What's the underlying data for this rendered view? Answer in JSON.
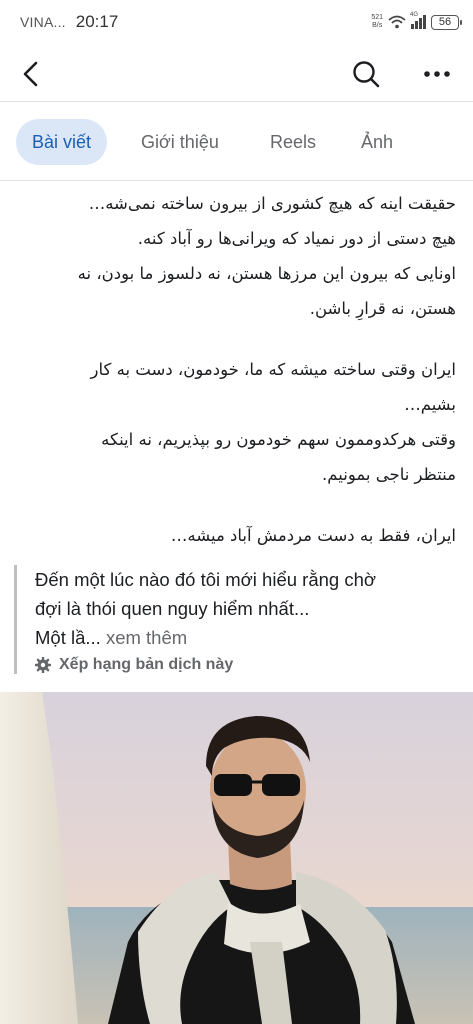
{
  "status_bar": {
    "carrier": "VINA...",
    "time": "20:17",
    "net_speed_top": "521",
    "net_speed_bottom": "B/s",
    "network_label": "4G",
    "battery": "56"
  },
  "nav": {
    "back_icon": "chevron-left-icon",
    "search_icon": "search-icon",
    "more_icon": "more-dots-icon"
  },
  "tabs": [
    {
      "label": "Bài viết",
      "active": true
    },
    {
      "label": "Giới thiệu",
      "active": false
    },
    {
      "label": "Reels",
      "active": false
    },
    {
      "label": "Ảnh",
      "active": false
    }
  ],
  "post": {
    "paragraphs": [
      [
        "حقیقت اینه که هیچ کشوری از بیرون ساخته نمی‌شه…",
        "هیچ دستی از دور نمیاد که ویرانی‌ها رو آباد کنه.",
        "اونایی که بیرون این مرزها هستن، نه دلسوز ما بودن، نه",
        "هستن، نه قرارِ باشن."
      ],
      [
        "ایران وقتی ساخته میشه که ما، خودمون، دست به کار",
        "بشیم…",
        "وقتی هرکدوممون سهم خودمون رو بپذیریم، نه اینکه",
        "منتظر ناجی بمونیم."
      ],
      [
        "ایران، فقط به دست مردمش آباد میشه…"
      ]
    ],
    "translation_line1": "Đến một lúc nào đó tôi mới hiểu rằng chờ",
    "translation_line2": "đợi là thói quen nguy hiểm nhất...",
    "translation_line3": "Một lầ...",
    "see_more": "xem thêm",
    "rate_icon": "gear-icon",
    "rate_label": "Xếp hạng bản dịch này"
  },
  "colors": {
    "tab_active_bg": "#dbe7f7",
    "tab_active_text": "#1a5fb4",
    "secondary_text": "#65676b"
  }
}
